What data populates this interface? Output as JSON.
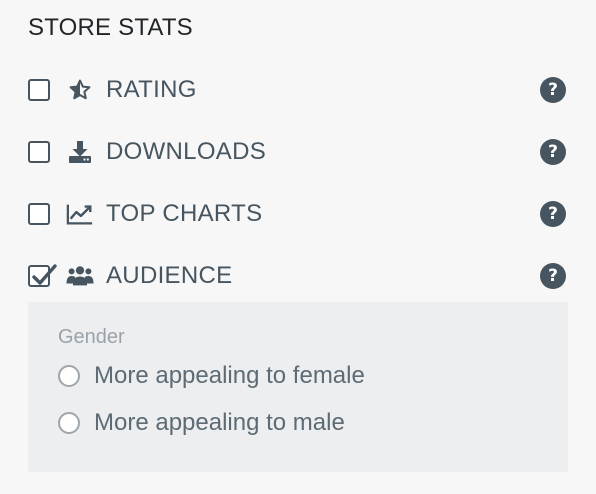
{
  "section": {
    "title": "STORE STATS"
  },
  "items": [
    {
      "label": "RATING",
      "icon": "star-half-icon",
      "checked": false,
      "help": "?"
    },
    {
      "label": "DOWNLOADS",
      "icon": "download-icon",
      "checked": false,
      "help": "?"
    },
    {
      "label": "TOP CHARTS",
      "icon": "line-chart-icon",
      "checked": false,
      "help": "?"
    },
    {
      "label": "AUDIENCE",
      "icon": "users-icon",
      "checked": true,
      "help": "?"
    }
  ],
  "audience_panel": {
    "label": "Gender",
    "options": [
      {
        "label": "More appealing to female",
        "selected": false
      },
      {
        "label": "More appealing to male",
        "selected": false
      }
    ]
  },
  "colors": {
    "text_dark": "#222629",
    "text_slate": "#46555f",
    "muted": "#9aa3a9",
    "subpanel_bg": "#edeef0",
    "page_bg": "#f7f7f7"
  }
}
